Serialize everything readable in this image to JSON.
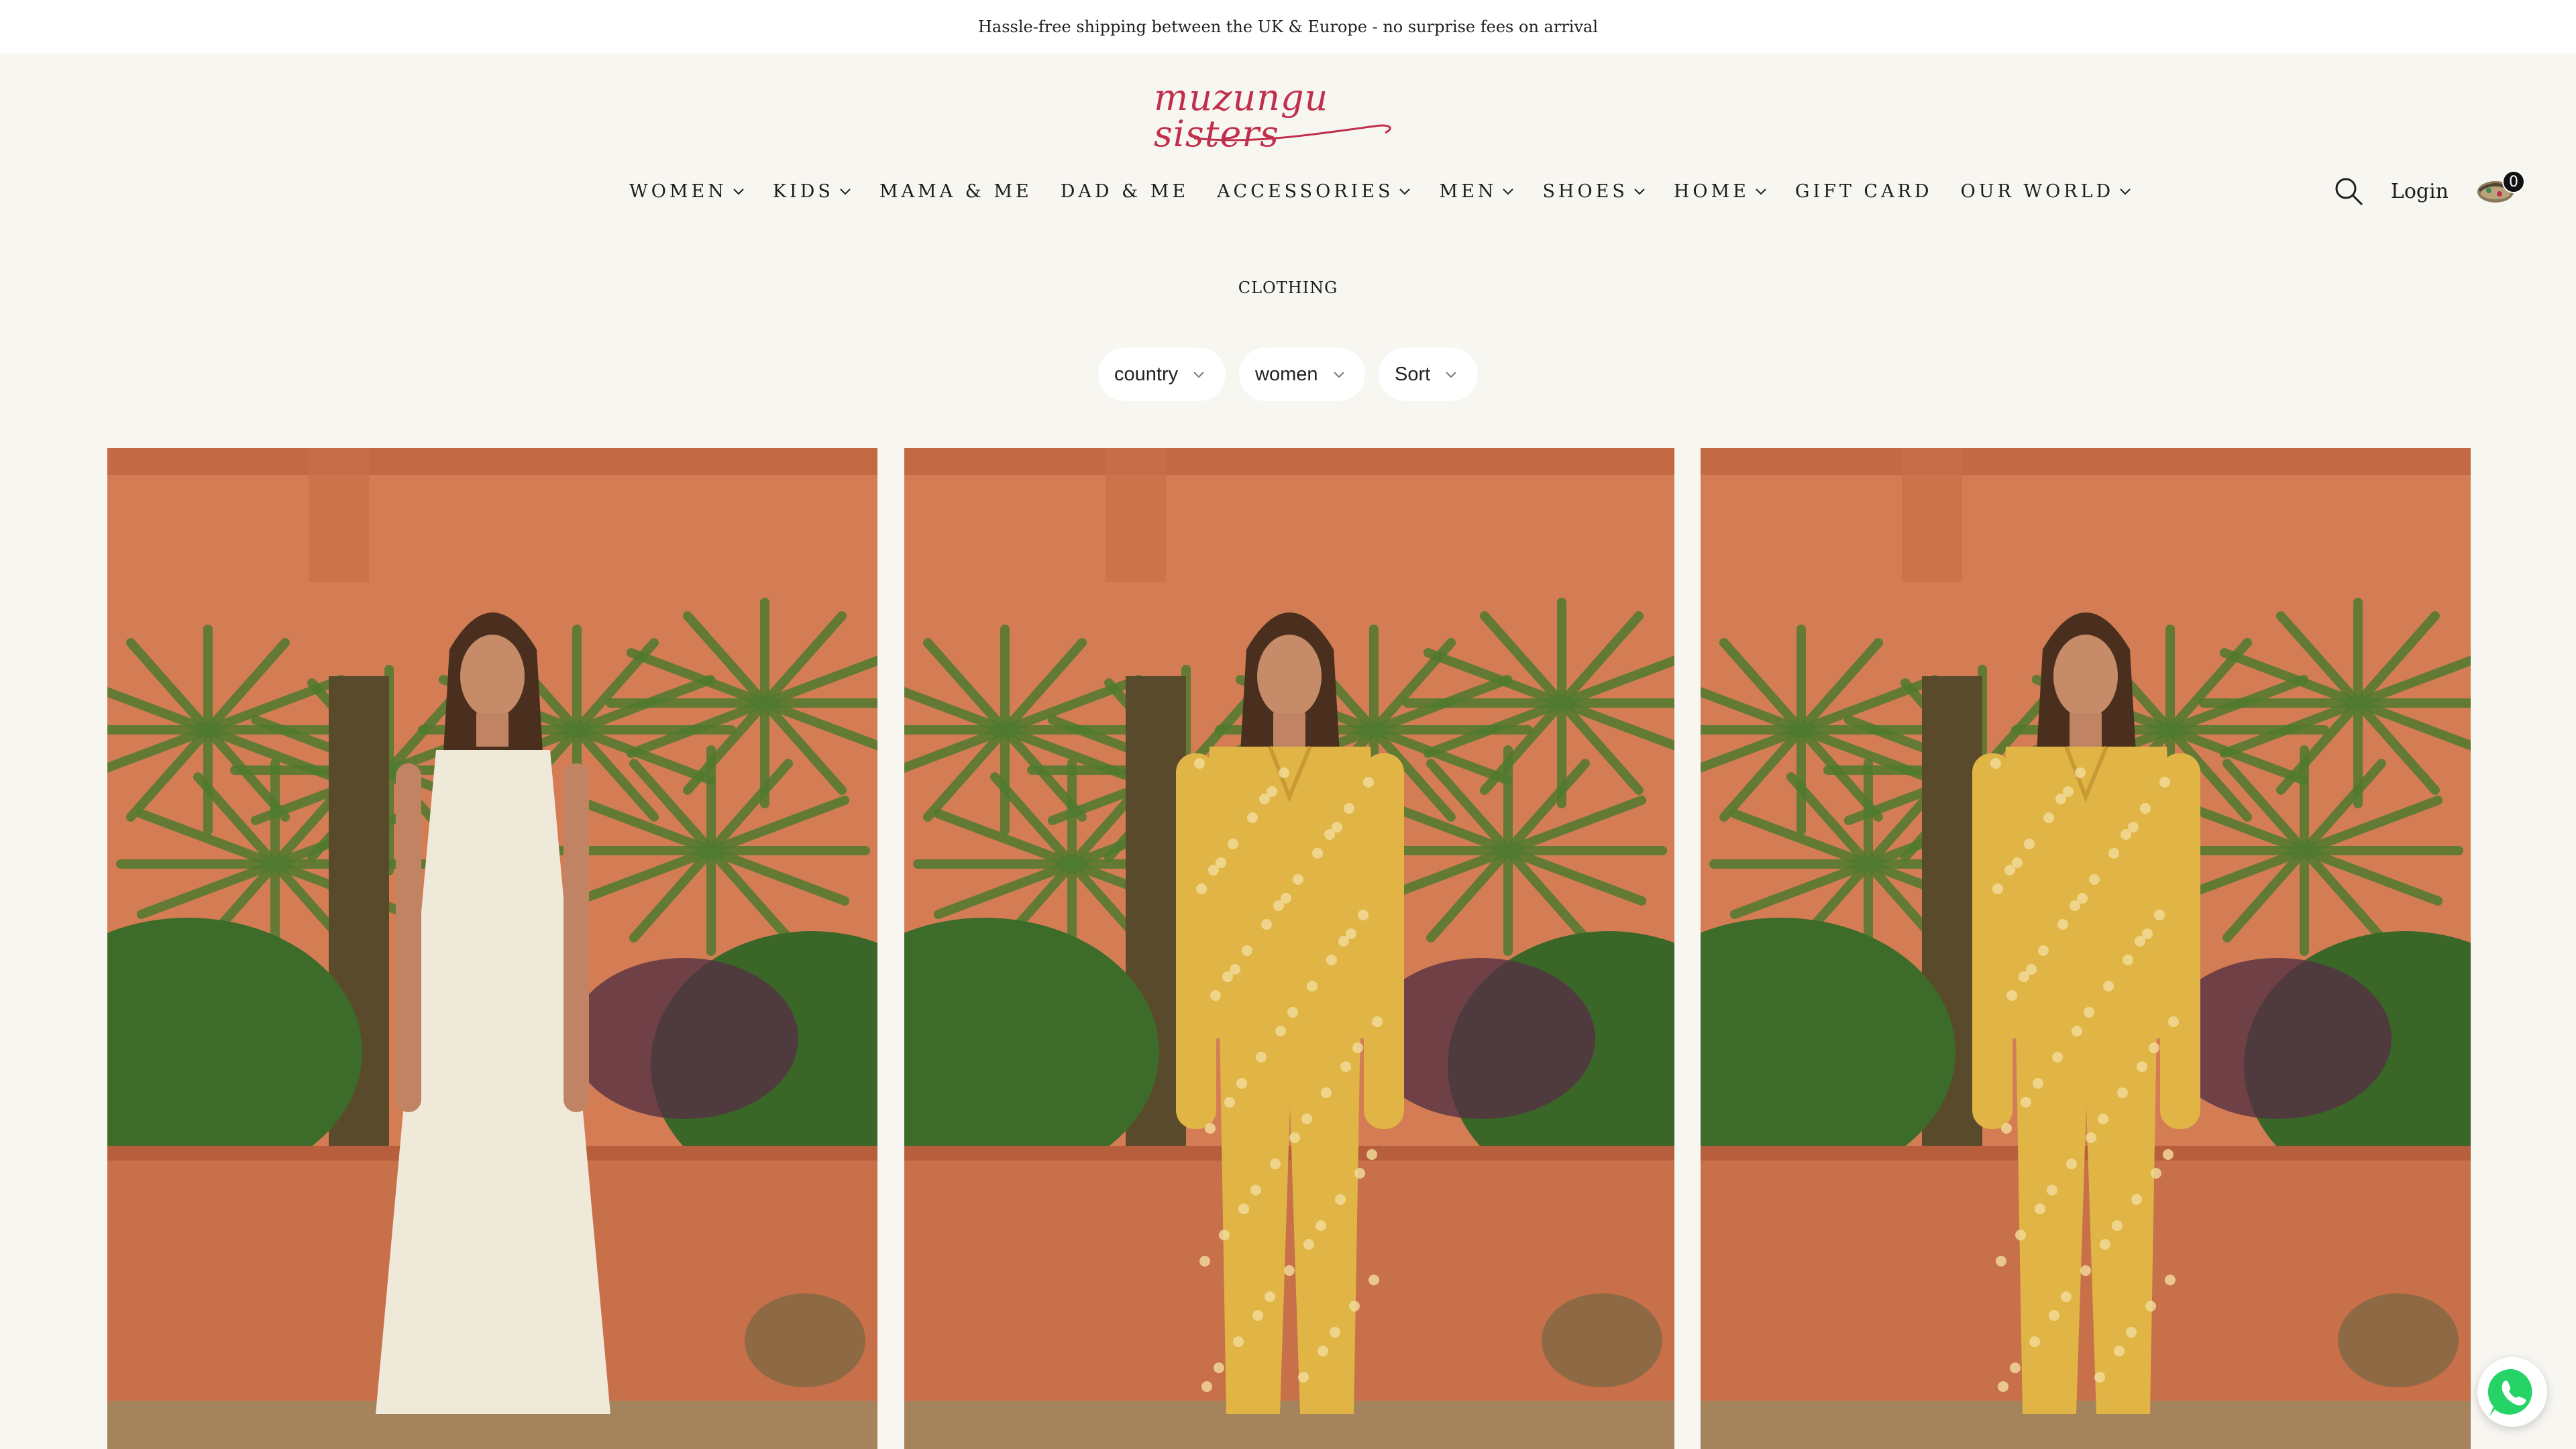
{
  "announcement": {
    "text": "Hassle-free shipping between the UK & Europe - no surprise fees on arrival"
  },
  "brand": {
    "logo_text": "muzungu sisters",
    "accent": "#c0304d"
  },
  "nav": {
    "items": [
      {
        "label": "WOMEN",
        "dropdown": true
      },
      {
        "label": "KIDS",
        "dropdown": true
      },
      {
        "label": "MAMA & ME",
        "dropdown": false
      },
      {
        "label": "DAD & ME",
        "dropdown": false
      },
      {
        "label": "ACCESSORIES",
        "dropdown": true
      },
      {
        "label": "MEN",
        "dropdown": true
      },
      {
        "label": "SHOES",
        "dropdown": true
      },
      {
        "label": "HOME",
        "dropdown": true
      },
      {
        "label": "GIFT CARD",
        "dropdown": false
      },
      {
        "label": "OUR WORLD",
        "dropdown": true
      }
    ]
  },
  "header": {
    "login_label": "Login",
    "cart_count": "0",
    "search_icon": "search-icon",
    "cart_icon": "basket-icon"
  },
  "collection": {
    "heading": "CLOTHING"
  },
  "filters": [
    {
      "label": "country"
    },
    {
      "label": "women"
    },
    {
      "label": "Sort"
    }
  ],
  "products": [
    {
      "image": "woman in white eyelet midi dress in garden",
      "garment_color": "#efe9da"
    },
    {
      "image": "woman in yellow floral shirt and trousers in garden",
      "garment_color": "#e0b545"
    },
    {
      "image": "woman in yellow floral shirt and trousers in garden",
      "garment_color": "#e0b545"
    }
  ],
  "colors": {
    "background": "#f8f6f1",
    "wall": "#d47d55",
    "whatsapp": "#25d366"
  },
  "whatsapp": {
    "icon": "whatsapp-icon"
  }
}
